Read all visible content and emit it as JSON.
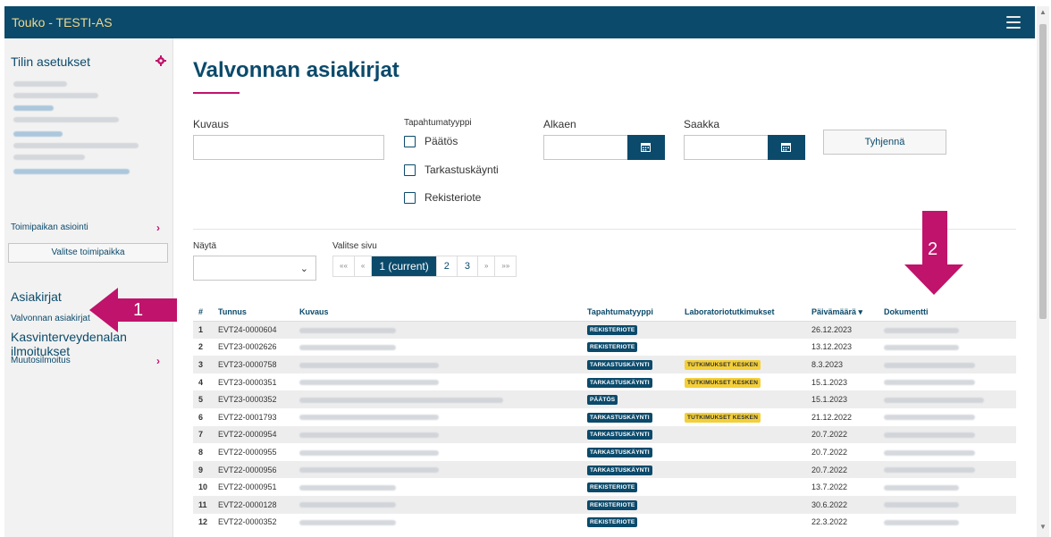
{
  "app": {
    "title": "Touko - TESTI-AS"
  },
  "sidebar": {
    "heading": "Tilin asetukset",
    "toimipaikan_link": "Toimipaikan asiointi",
    "select_button": "Valitse toimipaikka",
    "section_documents": "Asiakirjat",
    "active_item": "Valvonnan asiakirjat",
    "section_notifications": "Kasvinterveydenalan ilmoitukset",
    "muutos_link": "Muutosilmoitus"
  },
  "main": {
    "page_title": "Valvonnan asiakirjat",
    "filters": {
      "kuvaus_label": "Kuvaus",
      "type_label": "Tapahtumatyyppi",
      "types": [
        "Päätös",
        "Tarkastuskäynti",
        "Rekisteriote"
      ],
      "alkaen_label": "Alkaen",
      "saakka_label": "Saakka",
      "clear_button": "Tyhjennä"
    },
    "nayta_label": "Näytä",
    "pager": {
      "label": "Valitse sivu",
      "first": "««",
      "prev": "«",
      "current": "1 (current)",
      "pages": [
        "2",
        "3"
      ],
      "next": "»",
      "last": "»»"
    },
    "table": {
      "headers": [
        "#",
        "Tunnus",
        "Kuvaus",
        "Tapahtumatyyppi",
        "Laboratoriotutkimukset",
        "Päivämäärä ▾",
        "Dokumentti"
      ],
      "rows": [
        {
          "n": "1",
          "id": "EVT24-0000604",
          "type": "REKISTERIOTE",
          "lab": "",
          "date": "26.12.2023"
        },
        {
          "n": "2",
          "id": "EVT23-0002626",
          "type": "REKISTERIOTE",
          "lab": "",
          "date": "13.12.2023"
        },
        {
          "n": "3",
          "id": "EVT23-0000758",
          "type": "TARKASTUSKÄYNTI",
          "lab": "TUTKIMUKSET KESKEN",
          "date": "8.3.2023"
        },
        {
          "n": "4",
          "id": "EVT23-0000351",
          "type": "TARKASTUSKÄYNTI",
          "lab": "TUTKIMUKSET KESKEN",
          "date": "15.1.2023"
        },
        {
          "n": "5",
          "id": "EVT23-0000352",
          "type": "PÄÄTÖS",
          "lab": "",
          "date": "15.1.2023"
        },
        {
          "n": "6",
          "id": "EVT22-0001793",
          "type": "TARKASTUSKÄYNTI",
          "lab": "TUTKIMUKSET KESKEN",
          "date": "21.12.2022"
        },
        {
          "n": "7",
          "id": "EVT22-0000954",
          "type": "TARKASTUSKÄYNTI",
          "lab": "",
          "date": "20.7.2022"
        },
        {
          "n": "8",
          "id": "EVT22-0000955",
          "type": "TARKASTUSKÄYNTI",
          "lab": "",
          "date": "20.7.2022"
        },
        {
          "n": "9",
          "id": "EVT22-0000956",
          "type": "TARKASTUSKÄYNTI",
          "lab": "",
          "date": "20.7.2022"
        },
        {
          "n": "10",
          "id": "EVT22-0000951",
          "type": "REKISTERIOTE",
          "lab": "",
          "date": "13.7.2022"
        },
        {
          "n": "11",
          "id": "EVT22-0000128",
          "type": "REKISTERIOTE",
          "lab": "",
          "date": "30.6.2022"
        },
        {
          "n": "12",
          "id": "EVT22-0000352",
          "type": "REKISTERIOTE",
          "lab": "",
          "date": "22.3.2022"
        }
      ]
    }
  },
  "callouts": {
    "first": "1",
    "second": "2"
  },
  "colors": {
    "brand": "#0b4a6b",
    "accent": "#c0136b",
    "badge_yellow": "#f3cf3a"
  }
}
